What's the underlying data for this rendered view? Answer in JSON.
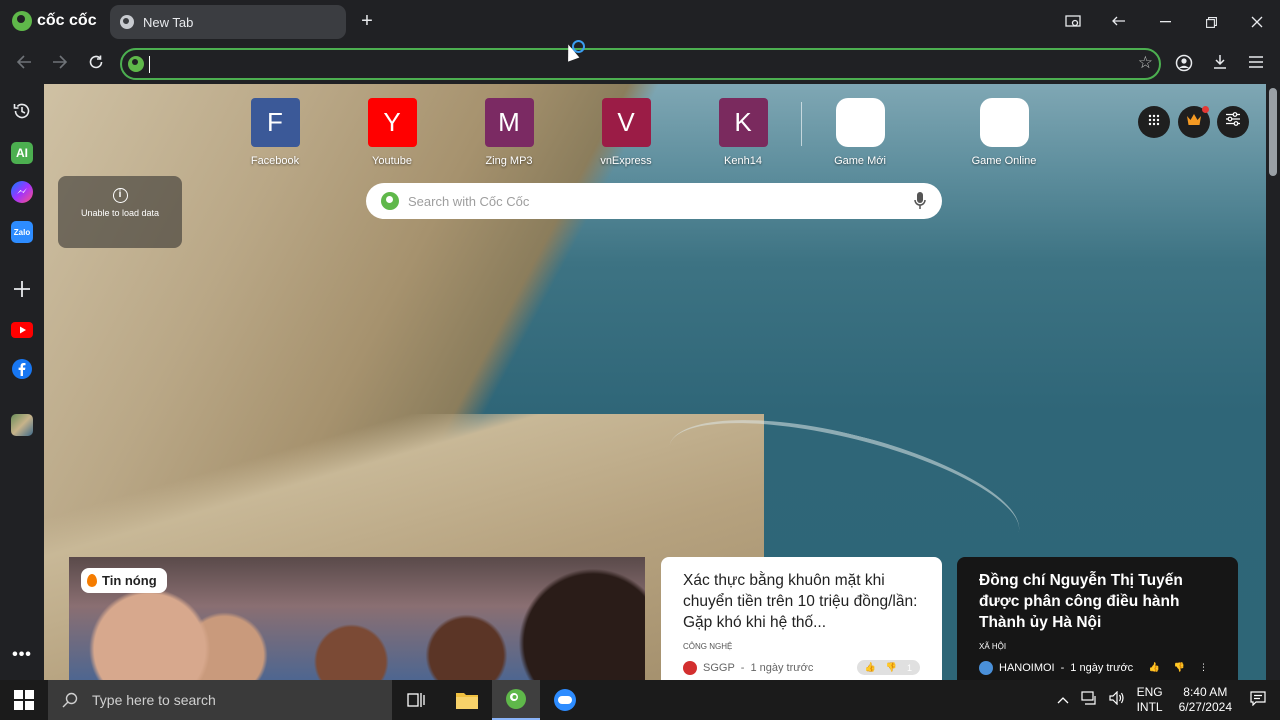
{
  "browser": {
    "brand": "cốc cốc",
    "tab_title": "New Tab"
  },
  "toolbar": {
    "omnibox_value": ""
  },
  "speed_dial": [
    {
      "letter": "F",
      "label": "Facebook",
      "color": "#3b5998"
    },
    {
      "letter": "Y",
      "label": "Youtube",
      "color": "#ff0000"
    },
    {
      "letter": "M",
      "label": "Zing MP3",
      "color": "#7b2a63"
    },
    {
      "letter": "V",
      "label": "vnExpress",
      "color": "#9b1c46"
    },
    {
      "letter": "K",
      "label": "Kenh14",
      "color": "#7a2a5e"
    },
    {
      "letter": "",
      "label": "Game Mới",
      "color": "#ffffff"
    },
    {
      "letter": "",
      "label": "Game Online",
      "color": "#ffffff"
    }
  ],
  "search": {
    "placeholder": "Search with Cốc Cốc"
  },
  "weather": {
    "message": "Unable to load data"
  },
  "news": {
    "hot_label": "Tin nóng",
    "card1": {
      "title": "Xác thực bằng khuôn mặt khi chuyển tiền trên 10 triệu đồng/lần: Gặp khó khi hệ thố...",
      "category": "CÔNG NGHỆ",
      "source": "SGGP",
      "time": "1 ngày trước",
      "count": "1"
    },
    "card2": {
      "title": "Đồng chí Nguyễn Thị Tuyến được phân công điều hành Thành ủy Hà Nội",
      "category": "XÃ HỘI",
      "source": "HANOIMOI",
      "time": "1 ngày trước"
    }
  },
  "taskbar": {
    "search_placeholder": "Type here to search",
    "language_top": "ENG",
    "language_bottom": "INTL",
    "time": "8:40 AM",
    "date": "6/27/2024"
  },
  "icons": {
    "history": "history-icon",
    "ai": "ai-assistant-icon",
    "messenger": "messenger-icon",
    "zalo": "zalo-icon",
    "add": "add-icon",
    "youtube": "youtube-icon",
    "facebook": "facebook-icon",
    "game": "game-icon",
    "more": "more-icon"
  },
  "colors": {
    "accent": "#4caf50",
    "brand": "#5fb84a"
  }
}
